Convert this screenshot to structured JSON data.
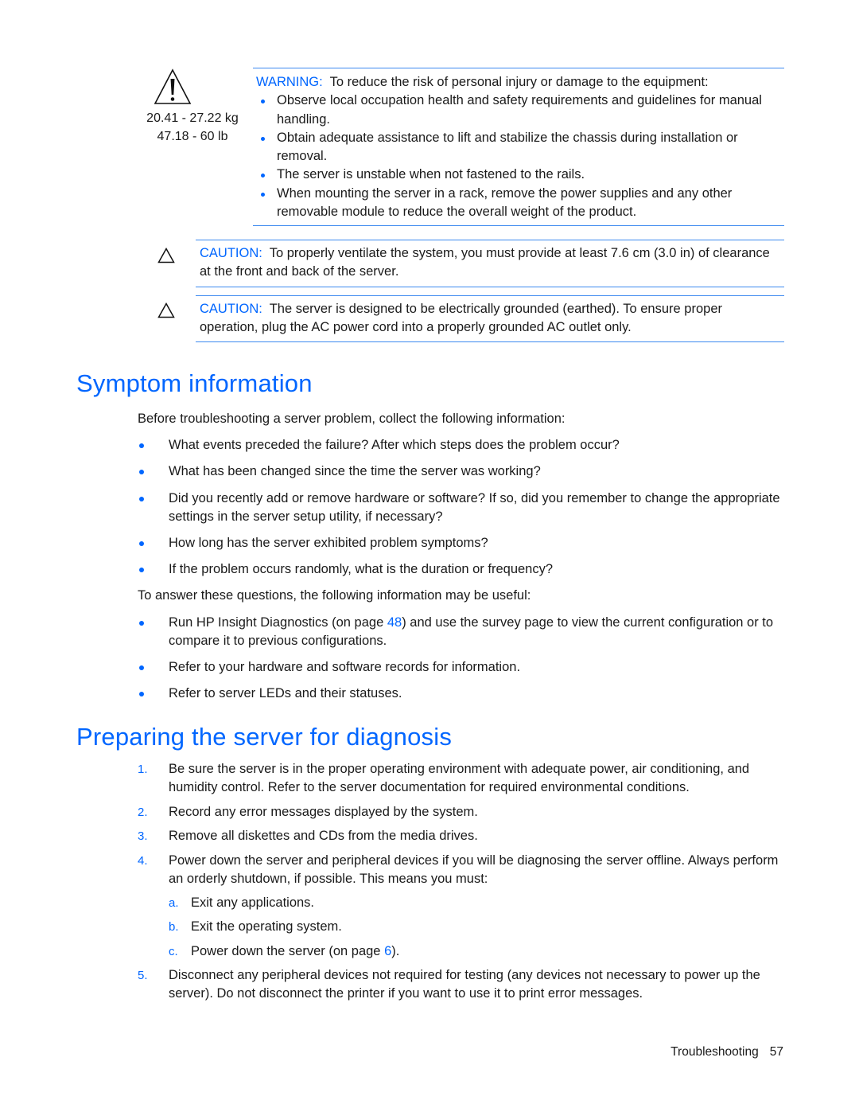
{
  "warning": {
    "icon": "warning-triangle-exclamation-icon",
    "weight_kg": "20.41 - 27.22 kg",
    "weight_lb": "47.18 - 60 lb",
    "label": "WARNING:",
    "lead": "To reduce the risk of personal injury or damage to the equipment:",
    "items": [
      "Observe local occupation health and safety requirements and guidelines for manual handling.",
      "Obtain adequate assistance to lift and stabilize the chassis during installation or removal.",
      "The server is unstable when not fastened to the rails.",
      "When mounting the server in a rack, remove the power supplies and any other removable module to reduce the overall weight of the product."
    ]
  },
  "cautions": [
    {
      "icon": "caution-triangle-icon",
      "label": "CAUTION:",
      "text": "To properly ventilate the system, you must provide at least 7.6 cm (3.0 in) of clearance at the front and back of the server."
    },
    {
      "icon": "caution-triangle-icon",
      "label": "CAUTION:",
      "text": "The server is designed to be electrically grounded (earthed). To ensure proper operation, plug the AC power cord into a properly grounded AC outlet only."
    }
  ],
  "symptom": {
    "title": "Symptom information",
    "intro": "Before troubleshooting a server problem, collect the following information:",
    "questions": [
      "What events preceded the failure? After which steps does the problem occur?",
      "What has been changed since the time the server was working?",
      "Did you recently add or remove hardware or software? If so, did you remember to change the appropriate settings in the server setup utility, if necessary?",
      "How long has the server exhibited problem symptoms?",
      "If the problem occurs randomly, what is the duration or frequency?"
    ],
    "useful_intro": "To answer these questions, the following information may be useful:",
    "useful": {
      "item1_before": "Run HP Insight Diagnostics (on page ",
      "item1_link": "48",
      "item1_after": ") and use the survey page to view the current configuration or to compare it to previous configurations.",
      "item2": "Refer to your hardware and software records for information.",
      "item3": "Refer to server LEDs and their statuses."
    }
  },
  "preparing": {
    "title": "Preparing the server for diagnosis",
    "steps": [
      {
        "num": "1.",
        "text": "Be sure the server is in the proper operating environment with adequate power, air conditioning, and humidity control. Refer to the server documentation for required environmental conditions."
      },
      {
        "num": "2.",
        "text": "Record any error messages displayed by the system."
      },
      {
        "num": "3.",
        "text": "Remove all diskettes and CDs from the media drives."
      },
      {
        "num": "4.",
        "text": "Power down the server and peripheral devices if you will be diagnosing the server offline. Always perform an orderly shutdown, if possible. This means you must:"
      },
      {
        "num": "5.",
        "text": "Disconnect any peripheral devices not required for testing (any devices not necessary to power up the server). Do not disconnect the printer if you want to use it to print error messages."
      }
    ],
    "substeps": [
      {
        "num": "a.",
        "text": "Exit any applications."
      },
      {
        "num": "b.",
        "text": "Exit the operating system."
      },
      {
        "num": "c.",
        "text_before": "Power down the server (on page ",
        "link": "6",
        "text_after": ")."
      }
    ]
  },
  "footer": {
    "section": "Troubleshooting",
    "page": "57"
  }
}
